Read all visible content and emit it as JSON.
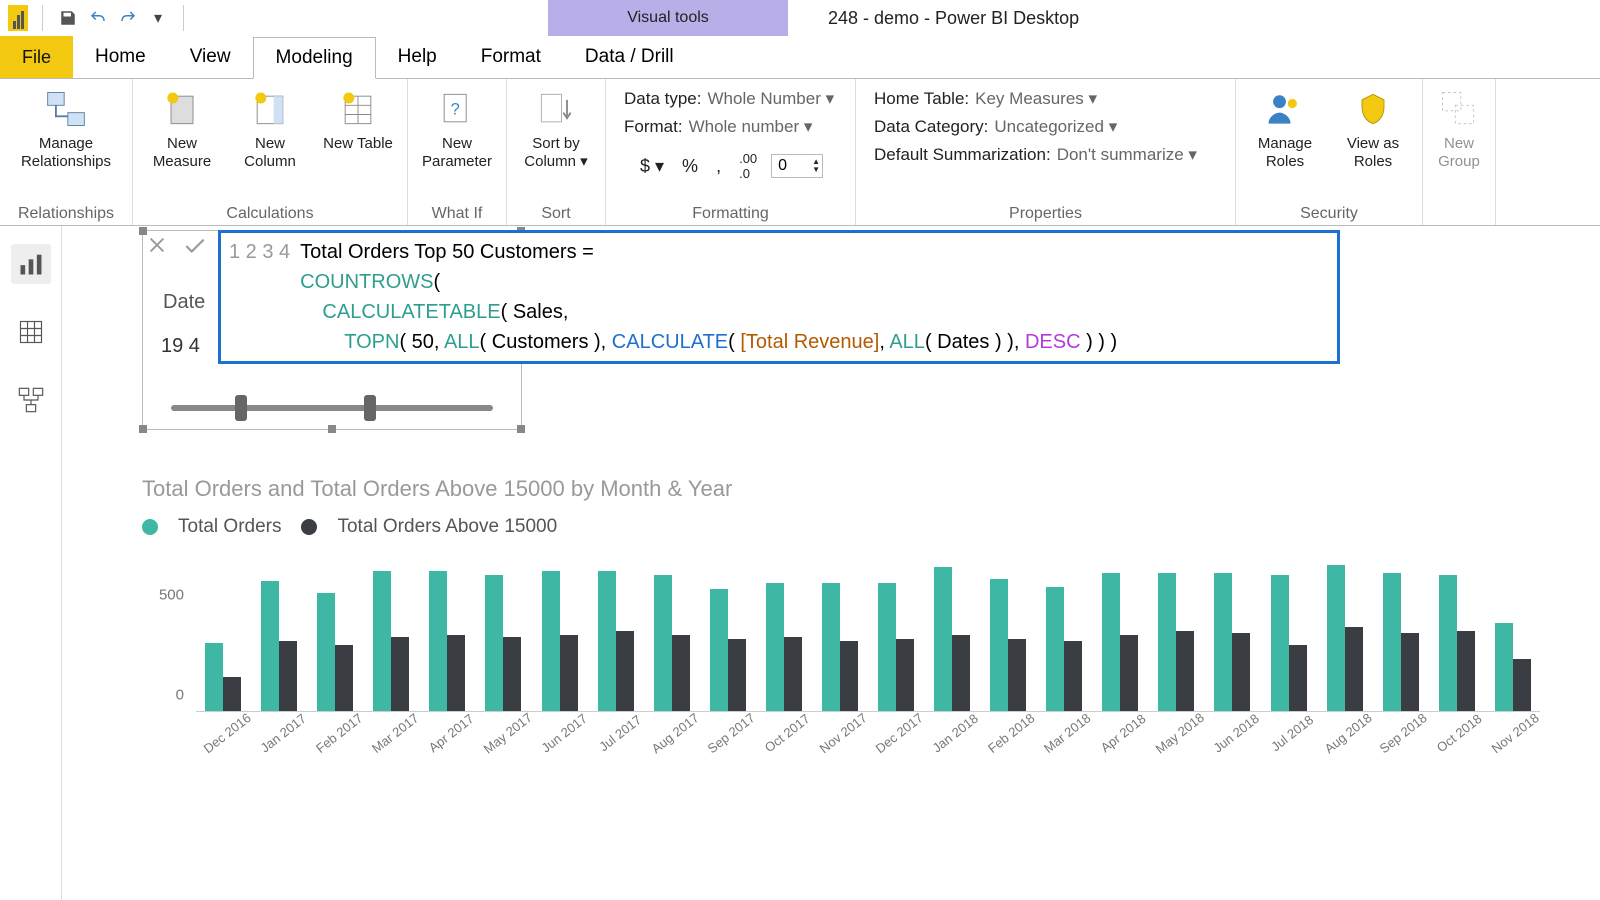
{
  "title_bar": {
    "contextual_tab": "Visual tools",
    "app_title": "248 - demo - Power BI Desktop"
  },
  "tabs": {
    "file": "File",
    "home": "Home",
    "view": "View",
    "modeling": "Modeling",
    "help": "Help",
    "format": "Format",
    "data_drill": "Data / Drill"
  },
  "ribbon": {
    "relationships_group": "Relationships",
    "manage_relationships": "Manage Relationships",
    "calculations_group": "Calculations",
    "new_measure": "New Measure",
    "new_column": "New Column",
    "new_table": "New Table",
    "whatif_group": "What If",
    "new_parameter": "New Parameter",
    "sort_group": "Sort",
    "sort_by_column": "Sort by Column",
    "formatting_group": "Formatting",
    "data_type_label": "Data type:",
    "data_type_value": "Whole Number",
    "format_label": "Format:",
    "format_value": "Whole number",
    "decimals": "0",
    "properties_group": "Properties",
    "home_table_label": "Home Table:",
    "home_table_value": "Key Measures",
    "data_category_label": "Data Category:",
    "data_category_value": "Uncategorized",
    "summarization_label": "Default Summarization:",
    "summarization_value": "Don't summarize",
    "security_group": "Security",
    "manage_roles": "Manage Roles",
    "view_as_roles": "View as Roles",
    "new_group": "New Group"
  },
  "formula": {
    "gutter": "1\n2\n3\n4",
    "line1": "Total Orders Top 50 Customers =",
    "fn_countrows": "COUNTROWS",
    "paren_open": "(",
    "fn_calctable": "CALCULATETABLE",
    "sales": "( Sales,",
    "fn_topn": "TOPN",
    "topn_args_a": "( 50, ",
    "fn_all1": "ALL",
    "all_cust": "( Customers ), ",
    "fn_calculate": "CALCULATE",
    "calc_open": "( ",
    "measure": "[Total Revenue]",
    "calc_mid": ", ",
    "fn_all2": "ALL",
    "all_dates": "( Dates ) ), ",
    "desc": "DESC",
    "close": " ) ) )"
  },
  "slicer": {
    "label": "Date",
    "value": "19 4"
  },
  "chart_data": {
    "type": "bar",
    "title": "Total Orders and Total Orders Above 15000 by Month & Year",
    "ylabel": "",
    "xlabel": "",
    "ylim": [
      0,
      800
    ],
    "y_ticks": [
      0,
      500
    ],
    "categories": [
      "Dec 2016",
      "Jan 2017",
      "Feb 2017",
      "Mar 2017",
      "Apr 2017",
      "May 2017",
      "Jun 2017",
      "Jul 2017",
      "Aug 2017",
      "Sep 2017",
      "Oct 2017",
      "Nov 2017",
      "Dec 2017",
      "Jan 2018",
      "Feb 2018",
      "Mar 2018",
      "Apr 2018",
      "May 2018",
      "Jun 2018",
      "Jul 2018",
      "Aug 2018",
      "Sep 2018",
      "Oct 2018",
      "Nov 2018"
    ],
    "series": [
      {
        "name": "Total Orders",
        "color": "#3EB8A5",
        "values": [
          340,
          650,
          590,
          700,
          700,
          680,
          700,
          700,
          680,
          610,
          640,
          640,
          640,
          720,
          660,
          620,
          690,
          690,
          690,
          680,
          730,
          690,
          680,
          440
        ]
      },
      {
        "name": "Total Orders Above 15000",
        "color": "#3A3E42",
        "values": [
          170,
          350,
          330,
          370,
          380,
          370,
          380,
          400,
          380,
          360,
          370,
          350,
          360,
          380,
          360,
          350,
          380,
          400,
          390,
          330,
          420,
          390,
          400,
          260
        ]
      }
    ],
    "legend": {
      "series1": "Total Orders",
      "series2": "Total Orders Above 15000"
    }
  }
}
